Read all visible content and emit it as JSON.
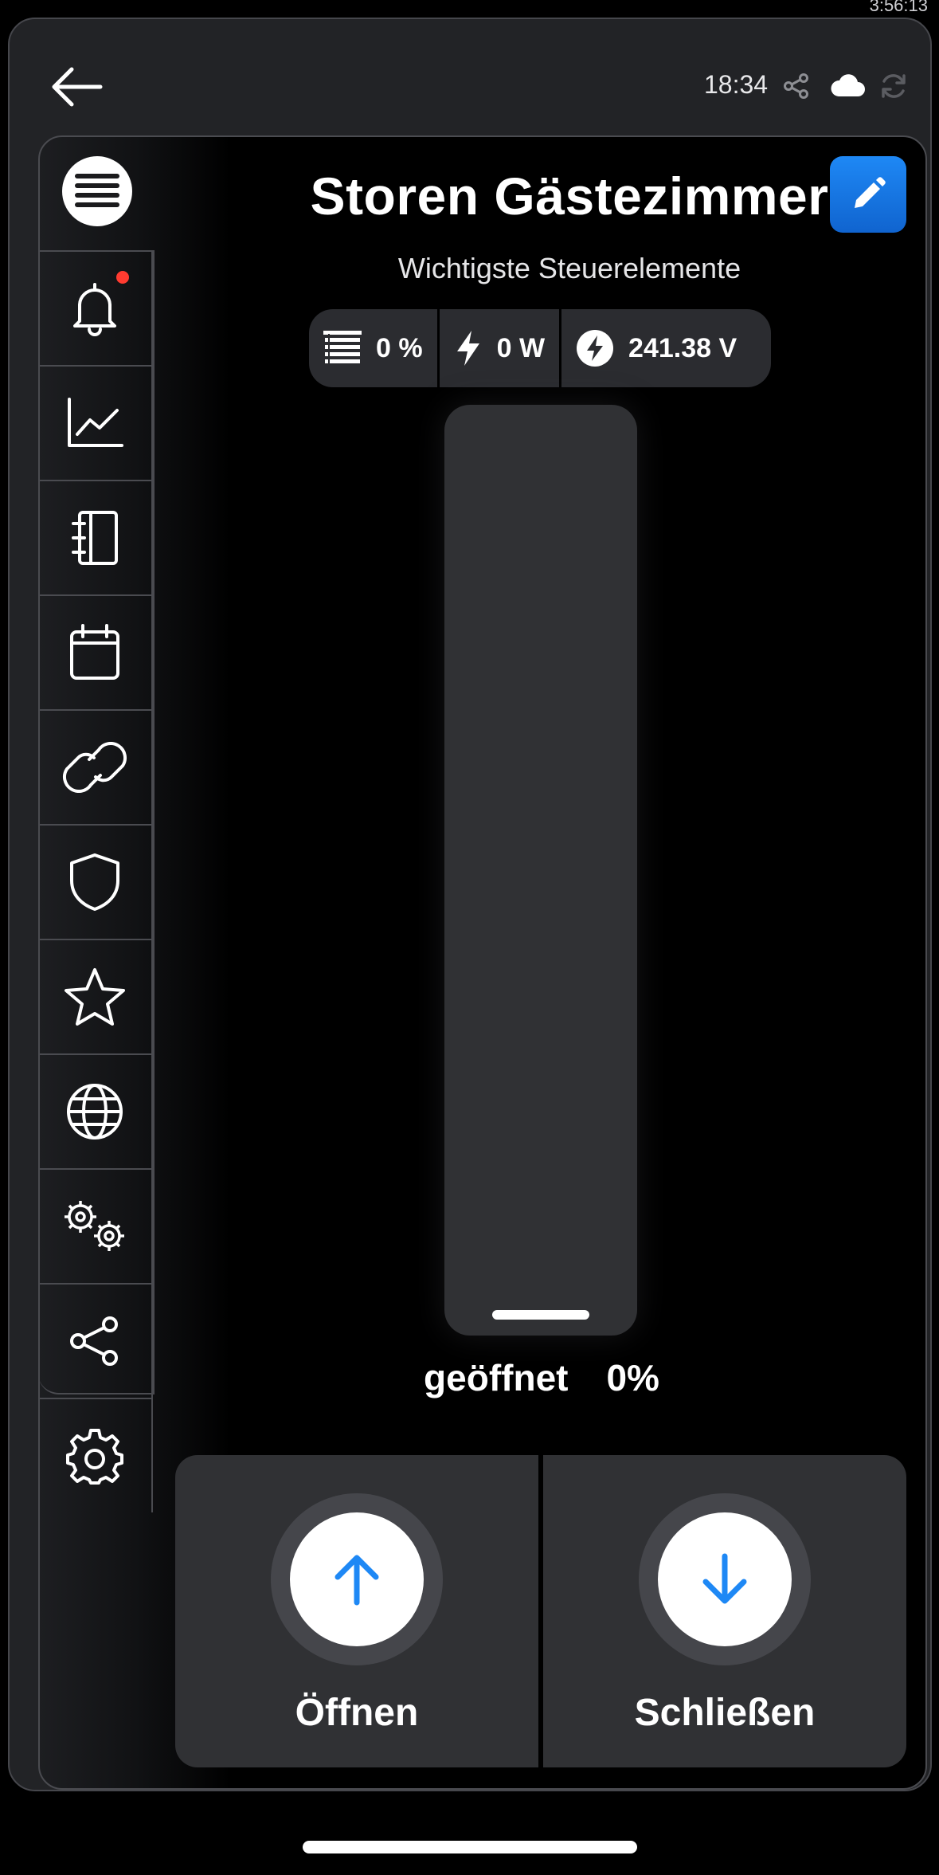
{
  "system": {
    "clock": "3:56:13"
  },
  "topbar": {
    "time": "18:34",
    "icons": [
      "arrow-left-icon",
      "share-icon",
      "cloud-icon",
      "refresh-icon"
    ]
  },
  "sidebar": {
    "items": [
      {
        "icon": "bell-icon",
        "has_badge": true
      },
      {
        "icon": "chart-line-icon"
      },
      {
        "icon": "notebook-icon"
      },
      {
        "icon": "calendar-icon"
      },
      {
        "icon": "link-icon"
      },
      {
        "icon": "shield-icon"
      },
      {
        "icon": "star-icon"
      },
      {
        "icon": "globe-icon"
      },
      {
        "icon": "gears-icon"
      },
      {
        "icon": "share-icon"
      },
      {
        "icon": "gear-icon"
      }
    ]
  },
  "device": {
    "title": "Storen Gästezimmer",
    "subtitle": "Wichtigste Steuerelemente",
    "stats": {
      "position": "0 %",
      "power": "0 W",
      "voltage": "241.38 V"
    },
    "state_label": "geöffnet",
    "state_value": "0%",
    "position_fraction": 0.0
  },
  "controls": {
    "open_label": "Öffnen",
    "close_label": "Schließen"
  },
  "colors": {
    "accent": "#1e88f5",
    "badge": "#ff3b30",
    "card": "#303134",
    "background": "#000000"
  }
}
